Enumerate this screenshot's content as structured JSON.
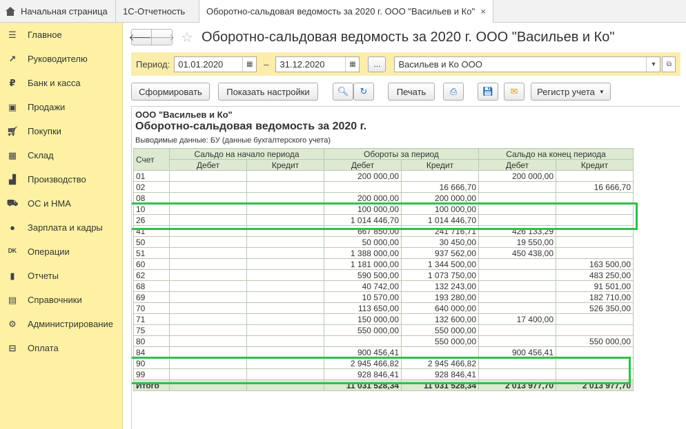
{
  "tabs": {
    "home": "Начальная страница",
    "reporting": "1С-Отчетность",
    "active": "Оборотно-сальдовая ведомость за 2020 г. ООО \"Васильев и Ко\"",
    "close": "×"
  },
  "sidebar": {
    "items": [
      {
        "label": "Главное",
        "icon": "menu-icon"
      },
      {
        "label": "Руководителю",
        "icon": "trend-icon"
      },
      {
        "label": "Банк и касса",
        "icon": "ruble-icon"
      },
      {
        "label": "Продажи",
        "icon": "bag-icon"
      },
      {
        "label": "Покупки",
        "icon": "cart-icon"
      },
      {
        "label": "Склад",
        "icon": "grid-icon"
      },
      {
        "label": "Производство",
        "icon": "factory-icon"
      },
      {
        "label": "ОС и НМА",
        "icon": "truck-icon"
      },
      {
        "label": "Зарплата и кадры",
        "icon": "person-icon"
      },
      {
        "label": "Операции",
        "icon": "dt-kt-icon"
      },
      {
        "label": "Отчеты",
        "icon": "bar-chart-icon"
      },
      {
        "label": "Справочники",
        "icon": "books-icon"
      },
      {
        "label": "Администрирование",
        "icon": "gear-icon"
      },
      {
        "label": "Оплата",
        "icon": "payment-icon"
      }
    ]
  },
  "title": "Оборотно-сальдовая ведомость за 2020 г. ООО \"Васильев и Ко\"",
  "period": {
    "label": "Период:",
    "from": "01.01.2020",
    "to": "31.12.2020",
    "dash": "–",
    "ellipsis": "...",
    "org": "Васильев и Ко ООО"
  },
  "toolbar": {
    "generate": "Сформировать",
    "settings": "Показать настройки",
    "print": "Печать",
    "register": "Регистр учета"
  },
  "report": {
    "org": "ООО \"Васильев и Ко\"",
    "title": "Оборотно-сальдовая ведомость за 2020 г.",
    "subtitle": "Выводимые данные:  БУ (данные бухгалтерского учета)",
    "headers": {
      "account": "Счет",
      "opening": "Сальдо на начало периода",
      "turnover": "Обороты за период",
      "closing": "Сальдо на конец периода",
      "debit": "Дебет",
      "credit": "Кредит"
    },
    "rows": [
      [
        "01",
        "",
        "",
        "200 000,00",
        "",
        "200 000,00",
        ""
      ],
      [
        "02",
        "",
        "",
        "",
        "16 666,70",
        "",
        "16 666,70"
      ],
      [
        "08",
        "",
        "",
        "200 000,00",
        "200 000,00",
        "",
        ""
      ],
      [
        "10",
        "",
        "",
        "100 000,00",
        "100 000,00",
        "",
        ""
      ],
      [
        "26",
        "",
        "",
        "1 014 446,70",
        "1 014 446,70",
        "",
        ""
      ],
      [
        "41",
        "",
        "",
        "667 850,00",
        "241 716,71",
        "426 133,29",
        ""
      ],
      [
        "50",
        "",
        "",
        "50 000,00",
        "30 450,00",
        "19 550,00",
        ""
      ],
      [
        "51",
        "",
        "",
        "1 388 000,00",
        "937 562,00",
        "450 438,00",
        ""
      ],
      [
        "60",
        "",
        "",
        "1 181 000,00",
        "1 344 500,00",
        "",
        "163 500,00"
      ],
      [
        "62",
        "",
        "",
        "590 500,00",
        "1 073 750,00",
        "",
        "483 250,00"
      ],
      [
        "68",
        "",
        "",
        "40 742,00",
        "132 243,00",
        "",
        "91 501,00"
      ],
      [
        "69",
        "",
        "",
        "10 570,00",
        "193 280,00",
        "",
        "182 710,00"
      ],
      [
        "70",
        "",
        "",
        "113 650,00",
        "640 000,00",
        "",
        "526 350,00"
      ],
      [
        "71",
        "",
        "",
        "150 000,00",
        "132 600,00",
        "17 400,00",
        ""
      ],
      [
        "75",
        "",
        "",
        "550 000,00",
        "550 000,00",
        "",
        ""
      ],
      [
        "80",
        "",
        "",
        "",
        "550 000,00",
        "",
        "550 000,00"
      ],
      [
        "84",
        "",
        "",
        "900 456,41",
        "",
        "900 456,41",
        ""
      ],
      [
        "90",
        "",
        "",
        "2 945 466,82",
        "2 945 466,82",
        "",
        ""
      ],
      [
        "99",
        "",
        "",
        "928 846,41",
        "928 846,41",
        "",
        ""
      ]
    ],
    "total": [
      "Итого",
      "",
      "",
      "11 031 528,34",
      "11 031 528,34",
      "2 013 977,70",
      "2 013 977,70"
    ]
  }
}
